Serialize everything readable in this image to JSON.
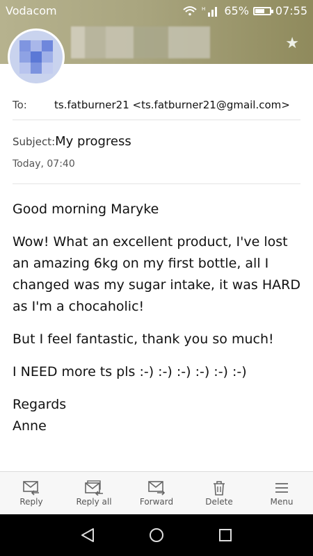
{
  "status_bar": {
    "carrier": "Vodacom",
    "network": "H",
    "battery_percent": "65%",
    "battery_level": 0.65,
    "time": "07:55"
  },
  "header": {
    "star_icon": "star-icon"
  },
  "email": {
    "to_label": "To:",
    "to_value": "ts.fatburner21 <ts.fatburner21@gmail.com>",
    "subject_label": "Subject:",
    "subject_value": "My progress",
    "date": "Today, 07:40",
    "body": {
      "greeting": "Good morning Maryke",
      "p1": "Wow! What an excellent product, I've lost an amazing 6kg on my first bottle, all I changed was my sugar intake, it was HARD as I'm a chocaholic!",
      "p2": "But I feel fantastic, thank you so much!",
      "p3": "I NEED more ts pls :-) :-) :-) :-) :-) :-)",
      "closing1": "Regards",
      "closing2": "Anne"
    }
  },
  "actions": [
    {
      "label": "Reply",
      "icon": "reply-icon"
    },
    {
      "label": "Reply all",
      "icon": "reply-all-icon"
    },
    {
      "label": "Forward",
      "icon": "forward-icon"
    },
    {
      "label": "Delete",
      "icon": "delete-icon"
    },
    {
      "label": "Menu",
      "icon": "menu-icon"
    }
  ],
  "nav": [
    "back-icon",
    "home-icon",
    "recents-icon"
  ]
}
